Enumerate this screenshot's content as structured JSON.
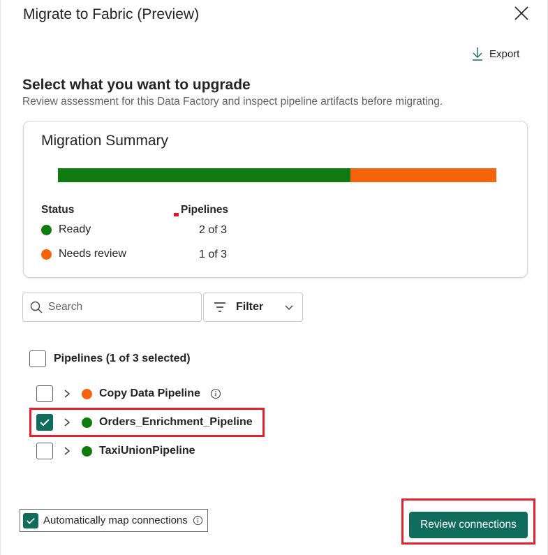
{
  "dialog": {
    "title": "Migrate to Fabric (Preview)",
    "close_icon": "close-icon",
    "export_label": "Export",
    "export_icon": "download-icon"
  },
  "section": {
    "heading": "Select what you want to upgrade",
    "subheading": "Review assessment for this Data Factory and inspect pipeline artifacts before migrating."
  },
  "summary": {
    "title": "Migration Summary",
    "progress": {
      "ready_fraction": 0.667,
      "review_fraction": 0.333
    },
    "status_header": "Status",
    "pipelines_header": "Pipelines",
    "rows": [
      {
        "label": "Ready",
        "count": "2 of 3",
        "color": "#107c10"
      },
      {
        "label": "Needs review",
        "count": "1 of 3",
        "color": "#f7630c"
      }
    ]
  },
  "search": {
    "placeholder": "Search",
    "icon": "search-icon"
  },
  "filter": {
    "label": "Filter",
    "icon": "filter-icon"
  },
  "pipelines": {
    "header": "Pipelines (1 of 3 selected)",
    "items": [
      {
        "name": "Copy Data Pipeline",
        "status": "Needs review",
        "checked": false,
        "has_info": true
      },
      {
        "name": "Orders_Enrichment_Pipeline",
        "status": "Ready",
        "checked": true,
        "has_info": false
      },
      {
        "name": "TaxiUnionPipeline",
        "status": "Ready",
        "checked": false,
        "has_info": false
      }
    ]
  },
  "footer": {
    "auto_map_label": "Automatically map connections",
    "auto_map_checked": true,
    "review_button": "Review connections"
  },
  "colors": {
    "accent": "#116d5b",
    "ready": "#107c10",
    "needs_review": "#f7630c",
    "highlight": "#e3202e"
  }
}
